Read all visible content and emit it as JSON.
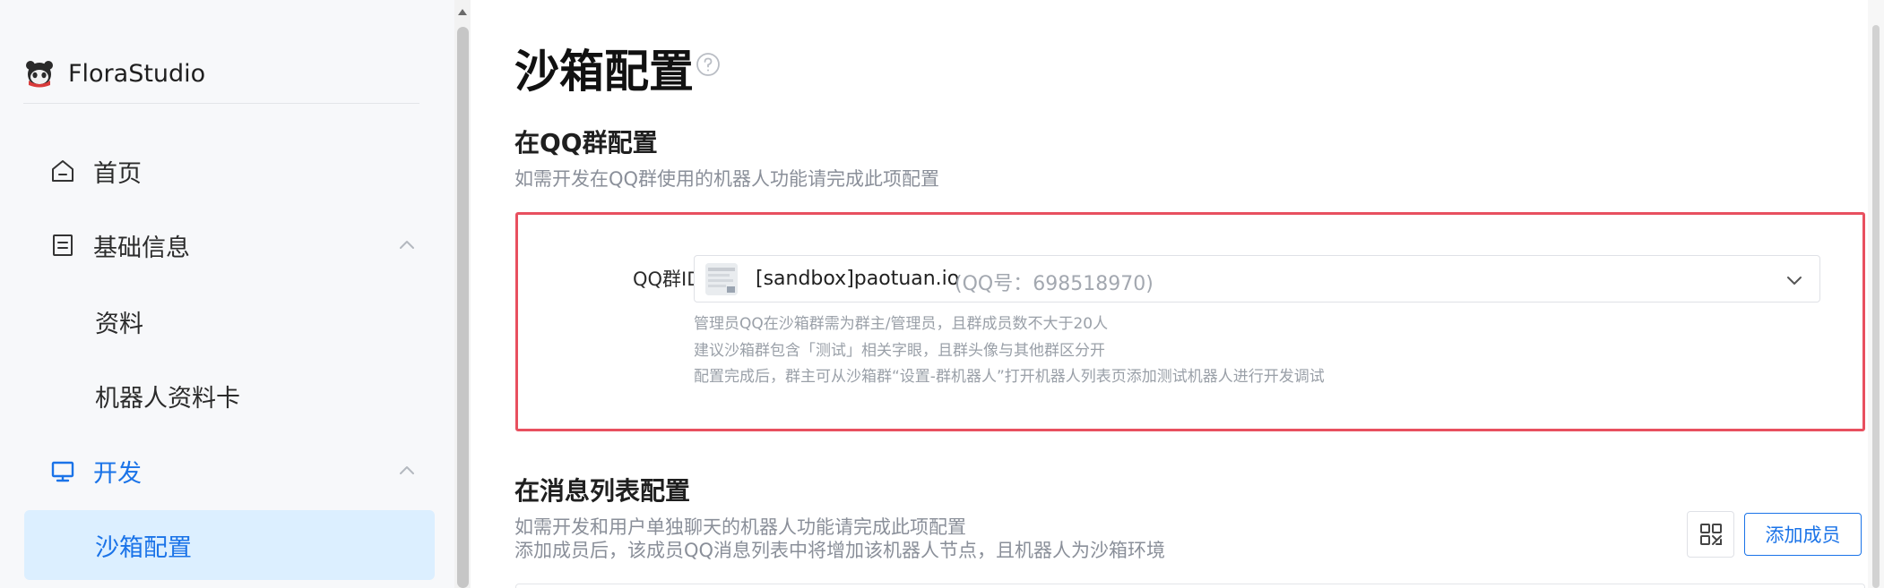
{
  "brand": {
    "name": "FloraStudio",
    "logo_icon": "panda-mascot-icon"
  },
  "sidebar": {
    "items": [
      {
        "label": "首页",
        "icon": "home-icon"
      },
      {
        "label": "基础信息",
        "icon": "document-icon",
        "expanded": true
      },
      {
        "label": "资料"
      },
      {
        "label": "机器人资料卡"
      },
      {
        "label": "开发",
        "icon": "monitor-icon",
        "expanded": true,
        "active": true
      },
      {
        "label": "沙箱配置",
        "selected": true
      }
    ]
  },
  "page": {
    "title": "沙箱配置",
    "help_icon": "question-circle-icon"
  },
  "qq_group_section": {
    "title": "在QQ群配置",
    "description": "如需开发在QQ群使用的机器人功能请完成此项配置",
    "field_label": "QQ群ID",
    "selected_group": {
      "name": "[sandbox]paotuan.io",
      "meta": "(QQ号：698518970)"
    },
    "hints": [
      "管理员QQ在沙箱群需为群主/管理员，且群成员数不大于20人",
      "建议沙箱群包含「测试」相关字眼，且群头像与其他群区分开",
      "配置完成后，群主可从沙箱群“设置-群机器人”打开机器人列表页添加测试机器人进行开发调试"
    ]
  },
  "message_list_section": {
    "title": "在消息列表配置",
    "description_lines": [
      "如需开发和用户单独聊天的机器人功能请完成此项配置",
      "添加成员后，该成员QQ消息列表中将增加该机器人节点，且机器人为沙箱环境"
    ],
    "qr_icon": "qr-code-icon",
    "add_member_label": "添加成员"
  },
  "colors": {
    "accent": "#1a73e8",
    "selected_bg": "#dcefff",
    "highlight_border": "#e8505f",
    "muted_text": "#8a8f99"
  }
}
